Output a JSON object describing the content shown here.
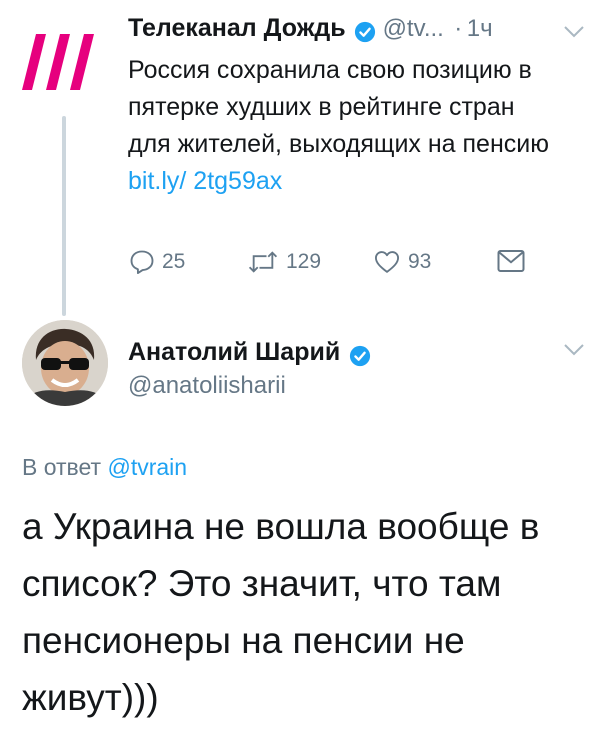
{
  "parent_tweet": {
    "author_name": "Телеканал Дождь",
    "handle": "@tv...",
    "separator": "·",
    "time": "1ч",
    "text": "Россия сохранила свою позицию в пятерке худших в рейтинге стран для жителей, выходящих на пенсию ",
    "link": "bit.ly/ 2tg59ax",
    "replies": "25",
    "retweets": "129",
    "likes": "93"
  },
  "reply_tweet": {
    "author_name": "Анатолий Шарий",
    "handle": "@anatoliisharii",
    "in_reply_prefix": "В ответ ",
    "in_reply_handle": "@tvrain",
    "text": "а Украина не вошла вообще в список? Это значит, что там пенсионеры на пенсии не живут)))"
  },
  "colors": {
    "accent": "#1da1f2",
    "brand": "#e6007e",
    "muted": "#657786"
  },
  "icons": [
    "verified-icon",
    "chevron-down-icon",
    "reply-icon",
    "retweet-icon",
    "like-icon",
    "direct-message-icon"
  ]
}
